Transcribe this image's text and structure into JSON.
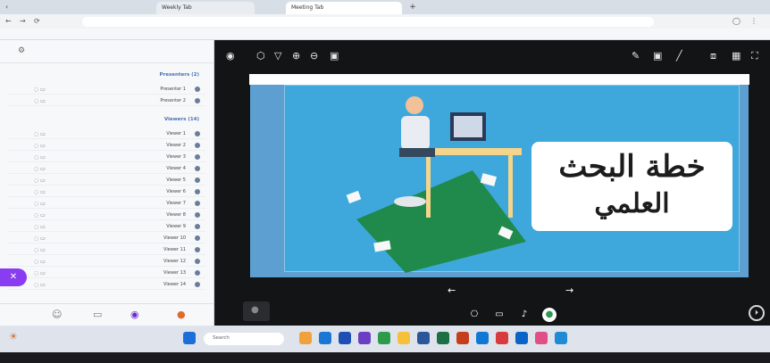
{
  "browser": {
    "tabs": [
      {
        "label": "Weekly Tab"
      },
      {
        "label": "Meeting Tab"
      }
    ],
    "new_tab": "+"
  },
  "sidebar": {
    "section_presenters": "Presenters (2)",
    "section_viewers": "Viewers (14)",
    "presenters": [
      {
        "name": "Presenter 1"
      },
      {
        "name": "Presenter 2"
      }
    ],
    "viewers": [
      {
        "name": "Viewer 1"
      },
      {
        "name": "Viewer 2"
      },
      {
        "name": "Viewer 3"
      },
      {
        "name": "Viewer 4"
      },
      {
        "name": "Viewer 5"
      },
      {
        "name": "Viewer 6"
      },
      {
        "name": "Viewer 7"
      },
      {
        "name": "Viewer 8"
      },
      {
        "name": "Viewer 9"
      },
      {
        "name": "Viewer 10"
      },
      {
        "name": "Viewer 11"
      },
      {
        "name": "Viewer 12"
      },
      {
        "name": "Viewer 13"
      },
      {
        "name": "Viewer 14"
      }
    ]
  },
  "slide": {
    "title_line1": "خطة البحث",
    "title_line2": "العلمي"
  },
  "taskbar": {
    "search_placeholder": "Search"
  },
  "colors": {
    "presenter_button": "#8a3df0",
    "slide_background": "#3ea8dc",
    "toolbar_bg": "#121416"
  }
}
